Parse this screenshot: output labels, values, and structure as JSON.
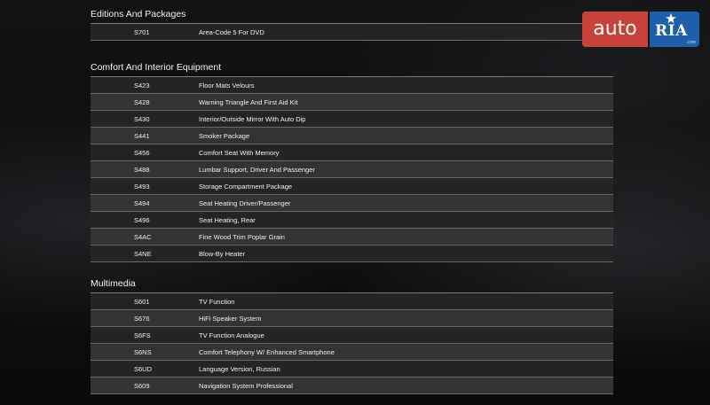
{
  "logo": {
    "auto": "auto",
    "ria": "RIA",
    "com": ".com"
  },
  "sections": [
    {
      "title": "Editions And Packages",
      "rows": [
        {
          "code": "S701",
          "desc": "Area-Code 5 For DVD"
        }
      ]
    },
    {
      "title": "Comfort And Interior Equipment",
      "rows": [
        {
          "code": "S423",
          "desc": "Floor Mats Velours"
        },
        {
          "code": "S428",
          "desc": "Warning Triangle And First Aid Kit"
        },
        {
          "code": "S430",
          "desc": "Interior/Outside Mirror With Auto Dip"
        },
        {
          "code": "S441",
          "desc": "Smoker Package"
        },
        {
          "code": "S456",
          "desc": "Comfort Seat With Memory"
        },
        {
          "code": "S488",
          "desc": "Lumbar Support, Driver And Passenger"
        },
        {
          "code": "S493",
          "desc": "Storage Compartment Package"
        },
        {
          "code": "S494",
          "desc": "Seat Heating Driver/Passenger"
        },
        {
          "code": "S496",
          "desc": "Seat Heating, Rear"
        },
        {
          "code": "S4AC",
          "desc": "Fine Wood Trim Poplar Grain"
        },
        {
          "code": "S4NE",
          "desc": "Blow-By Heater"
        }
      ]
    },
    {
      "title": "Multimedia",
      "rows": [
        {
          "code": "S601",
          "desc": "TV Function"
        },
        {
          "code": "S676",
          "desc": "HiFi Speaker System"
        },
        {
          "code": "S6FS",
          "desc": "TV Function Analogue"
        },
        {
          "code": "S6NS",
          "desc": "Comfort Telephony W/ Enhanced Smartphone"
        },
        {
          "code": "S6UD",
          "desc": "Language Version, Russian"
        },
        {
          "code": "S609",
          "desc": "Navigation System Professional"
        }
      ]
    }
  ]
}
